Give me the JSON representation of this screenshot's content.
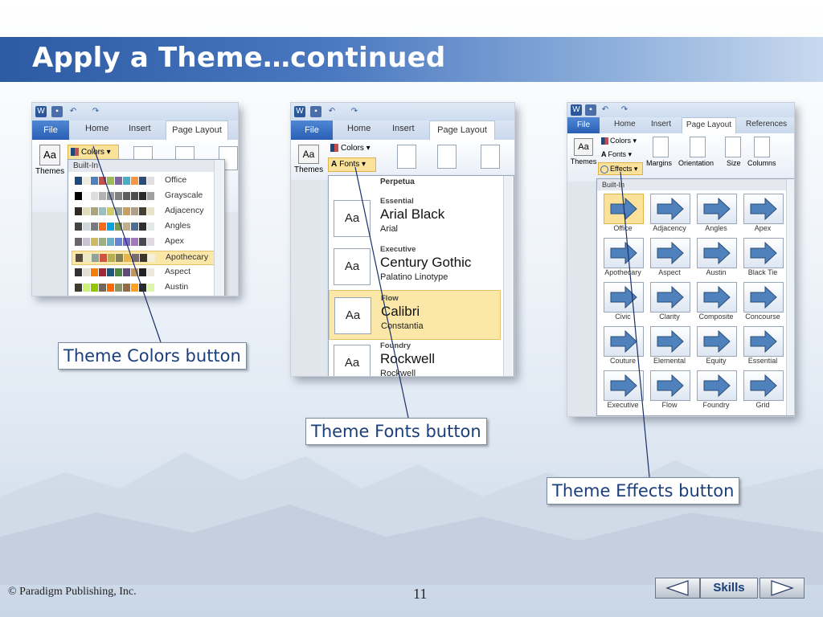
{
  "slide": {
    "title": "Apply a Theme…continued",
    "copyright": "© Paradigm Publishing, Inc.",
    "page_number": "11",
    "skills_label": "Skills"
  },
  "ribbon_tabs": {
    "file": "File",
    "home": "Home",
    "insert": "Insert",
    "page_layout": "Page Layout",
    "references": "References"
  },
  "ribbon_labels": {
    "themes": "Themes",
    "colors": "Colors ▾",
    "fonts": "Fonts ▾",
    "effects": "Effects ▾",
    "margins": "Margins",
    "orientation": "Orientation",
    "size": "Size",
    "columns": "Columns"
  },
  "colors_dropdown": {
    "header": "Built-In",
    "items": [
      {
        "name": "Office",
        "swatches": [
          "#1f497d",
          "#eeece1",
          "#4f81bd",
          "#c0504d",
          "#9bbb59",
          "#8064a2",
          "#4bacc6",
          "#f79646",
          "#2c4d75",
          "#e0e0e0"
        ]
      },
      {
        "name": "Grayscale",
        "swatches": [
          "#000000",
          "#f8f8f8",
          "#dddddd",
          "#b2b2b2",
          "#969696",
          "#808080",
          "#5f5f5f",
          "#4d4d4d",
          "#292929",
          "#a0a0a0"
        ]
      },
      {
        "name": "Adjacency",
        "swatches": [
          "#2f2b20",
          "#dfdcb7",
          "#a9a57c",
          "#9cbebd",
          "#d2cb6c",
          "#95a39d",
          "#c89f5d",
          "#b1a089",
          "#443f31",
          "#e6e3c9"
        ]
      },
      {
        "name": "Angles",
        "swatches": [
          "#434342",
          "#cdd7d9",
          "#797b7e",
          "#f96a1b",
          "#08a1d9",
          "#7c984a",
          "#c2ad8d",
          "#506e94",
          "#2f2f2f",
          "#e3e8e9"
        ]
      },
      {
        "name": "Apex",
        "swatches": [
          "#69676d",
          "#c9c2d1",
          "#ceb966",
          "#9cb084",
          "#6bb1c9",
          "#6585cf",
          "#7e6bc9",
          "#a379bb",
          "#4a4850",
          "#ddd8e3"
        ]
      },
      {
        "name": "Apothecary",
        "swatches": [
          "#564b3c",
          "#ece9c6",
          "#93a299",
          "#cf543f",
          "#b5ae53",
          "#848058",
          "#e8b54d",
          "#786c71",
          "#3d352a",
          "#f2f0da"
        ]
      },
      {
        "name": "Aspect",
        "swatches": [
          "#323232",
          "#e3ded1",
          "#f07f09",
          "#9f2936",
          "#1b587c",
          "#4e8542",
          "#604878",
          "#c19859",
          "#222222",
          "#ece8de"
        ]
      },
      {
        "name": "Austin",
        "swatches": [
          "#3e3d2d",
          "#caf278",
          "#94c600",
          "#71685a",
          "#ff6700",
          "#909465",
          "#956b43",
          "#fea022",
          "#2b2a1f",
          "#ddf7a8"
        ]
      }
    ],
    "highlighted": "Apothecary"
  },
  "fonts_dropdown": {
    "top_partial": "Perpetua",
    "items": [
      {
        "category": "Essential",
        "heading": "Arial Black",
        "body": "Arial"
      },
      {
        "category": "Executive",
        "heading": "Century Gothic",
        "body": "Palatino Linotype"
      },
      {
        "category": "Flow",
        "heading": "Calibri",
        "body": "Constantia"
      },
      {
        "category": "Foundry",
        "heading": "Rockwell",
        "body": "Rockwell"
      }
    ],
    "thumb_label": "Aa",
    "highlighted": "Flow"
  },
  "effects_dropdown": {
    "header": "Built-In",
    "items": [
      "Office",
      "Adjacency",
      "Angles",
      "Apex",
      "Apothecary",
      "Aspect",
      "Austin",
      "Black Tie",
      "Civic",
      "Clarity",
      "Composite",
      "Concourse",
      "Couture",
      "Elemental",
      "Equity",
      "Essential",
      "Executive",
      "Flow",
      "Foundry",
      "Grid"
    ],
    "highlighted": "Office"
  },
  "callouts": {
    "colors": "Theme Colors button",
    "fonts": "Theme Fonts button",
    "effects": "Theme Effects button"
  },
  "colors": {
    "title_bar": "#3a68b2",
    "callout_text": "#1b3f7a",
    "highlight": "#fbe7a8"
  }
}
